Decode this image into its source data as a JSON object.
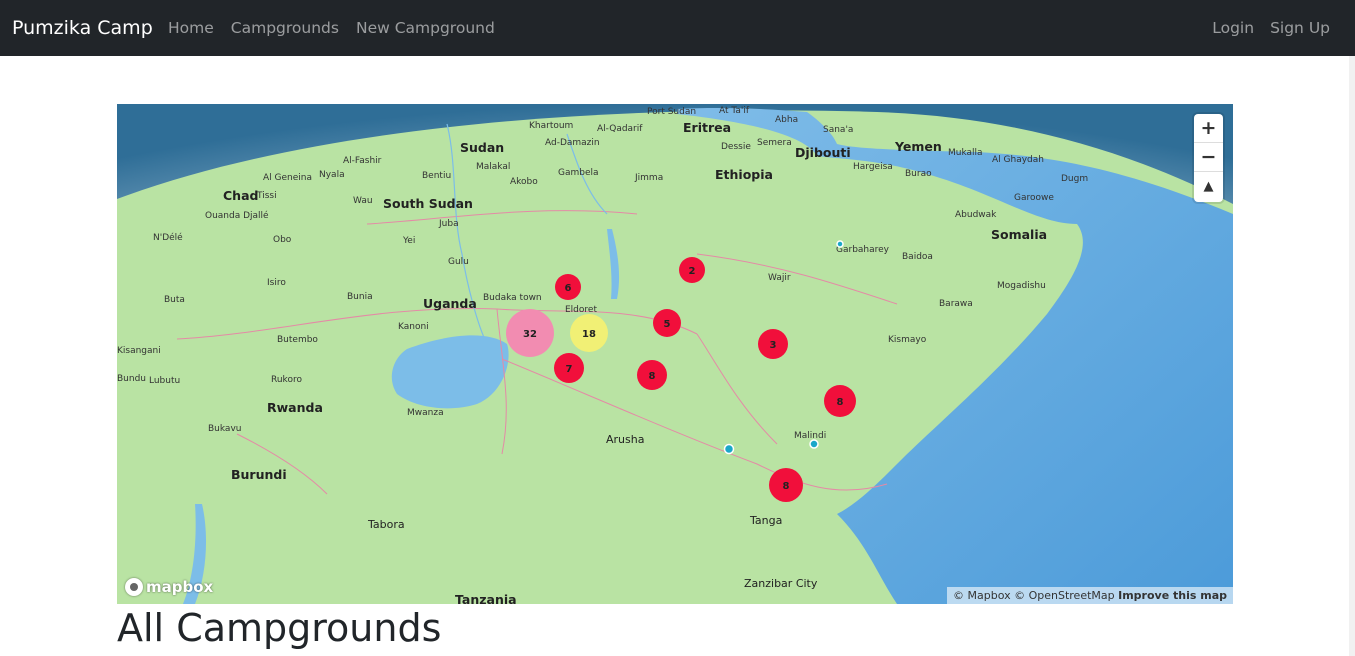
{
  "navbar": {
    "brand": "Pumzika Camp",
    "links": [
      "Home",
      "Campgrounds",
      "New Campground"
    ],
    "auth": [
      "Login",
      "Sign Up"
    ]
  },
  "map": {
    "zoom_in": "+",
    "zoom_out": "−",
    "compass": "▲",
    "logo_text": "mapbox",
    "attribution": "© Mapbox © OpenStreetMap",
    "improve": "Improve this map",
    "country_labels": [
      "Sudan",
      "South Sudan",
      "Ethiopia",
      "Eritrea",
      "Djibouti",
      "Yemen",
      "Somalia",
      "Uganda",
      "Rwanda",
      "Burundi",
      "Chad",
      "Tanzania"
    ],
    "city_labels": [
      "Khartoum",
      "Port Sudan",
      "At Ta'if",
      "Abha",
      "Sana'a",
      "Al-Qadarif",
      "Ad-Damazin",
      "Dessie",
      "Semera",
      "Hargeisa",
      "Mukalla",
      "Al Ghaydah",
      "Al-Fashir",
      "Al Geneina",
      "Nyala",
      "Malakal",
      "Bentiu",
      "Akobo",
      "Gambela",
      "Jimma",
      "Burao",
      "Dugm",
      "Garoowe",
      "Abudwak",
      "Wau",
      "Juba",
      "Tissi",
      "Ouanda Djallé",
      "N'Délé",
      "Obo",
      "Yei",
      "Gulu",
      "Garbaharey",
      "Baidoa",
      "Wajir",
      "Mogadishu",
      "Barawa",
      "Kismayo",
      "Budaka town",
      "Eldoret",
      "Kanoni",
      "Butembo",
      "Bunia",
      "Buta",
      "Isiro",
      "Kisangani",
      "Lubutu",
      "Bundu",
      "Rukoro",
      "Mwanza",
      "Bukavu",
      "Arusha",
      "Malindi",
      "Tanga",
      "Tabora",
      "Zanzibar City"
    ],
    "clusters": [
      {
        "count": "6",
        "color": "#f10f3b"
      },
      {
        "count": "2",
        "color": "#f10f3b"
      },
      {
        "count": "32",
        "color": "#f28cb1"
      },
      {
        "count": "18",
        "color": "#f1f075"
      },
      {
        "count": "5",
        "color": "#f10f3b"
      },
      {
        "count": "3",
        "color": "#f10f3b"
      },
      {
        "count": "7",
        "color": "#f10f3b"
      },
      {
        "count": "8",
        "color": "#f10f3b"
      },
      {
        "count": "8",
        "color": "#f10f3b"
      },
      {
        "count": "8",
        "color": "#f10f3b"
      }
    ]
  },
  "page": {
    "heading": "All Campgrounds"
  },
  "colors": {
    "navbar_bg": "#212529",
    "land": "#b7e3a0",
    "water": "#5ba6e0"
  }
}
